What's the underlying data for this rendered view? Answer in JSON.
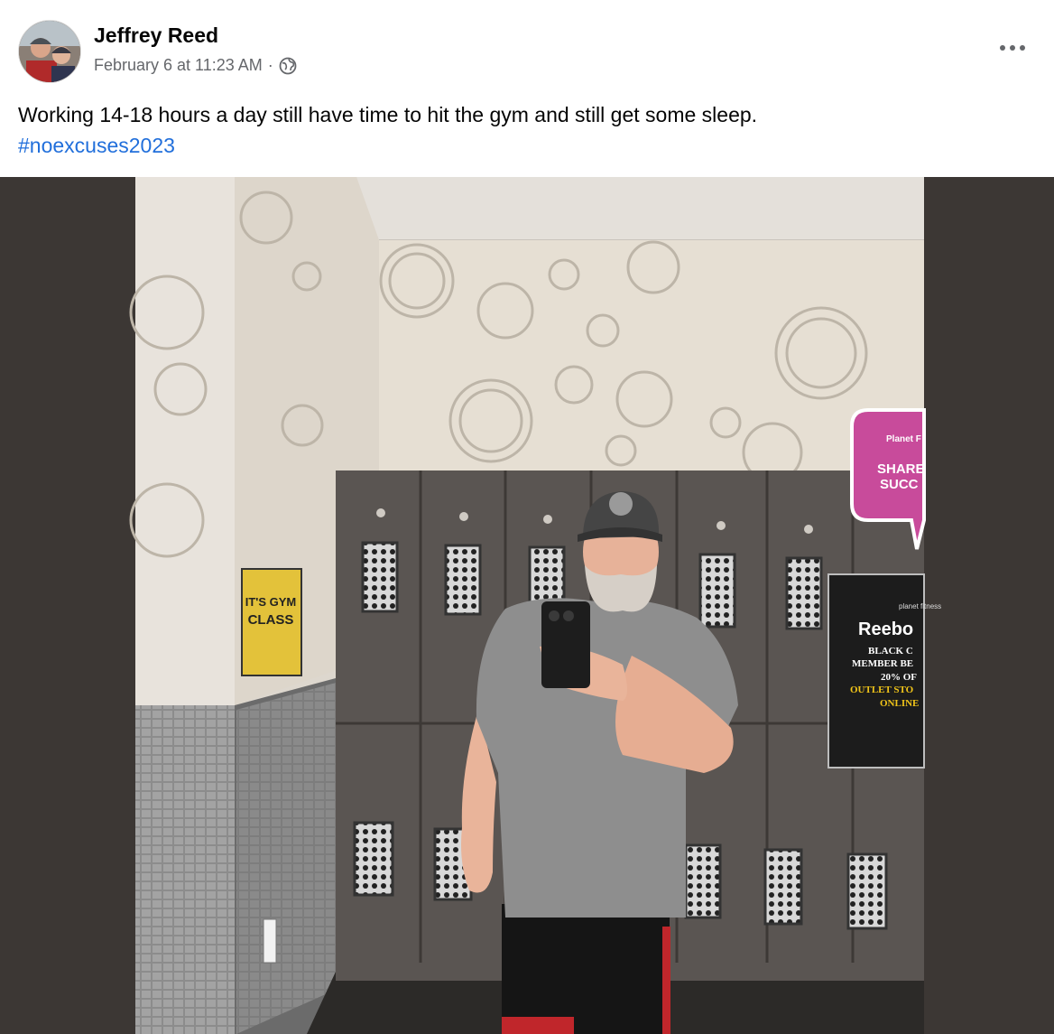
{
  "post": {
    "author": "Jeffrey Reed",
    "timestamp": "February 6 at 11:23 AM",
    "separator": "·",
    "privacy_icon": "globe-icon",
    "more_icon": "more-options-icon",
    "text": "Working 14-18 hours a day still have time to hit the gym and still get some sleep.",
    "hashtag": "#noexcuses2023"
  },
  "photo": {
    "gym_sign": {
      "line1": "IT'S GYM",
      "line2": "CLASS"
    },
    "share_sign": {
      "brand": "Planet F",
      "line1": "SHARE",
      "line2": "SUCC"
    },
    "promo_sign": {
      "brand": "planet fitness",
      "title": "Reebo",
      "line1": "BLACK C",
      "line2": "MEMBER BE",
      "line3": "20% OF",
      "line4": "OUTLET STO",
      "line5": "ONLINE"
    }
  },
  "colors": {
    "link": "#216fdb",
    "text": "#050505",
    "meta": "#65676b",
    "frame": "#3c3734"
  }
}
